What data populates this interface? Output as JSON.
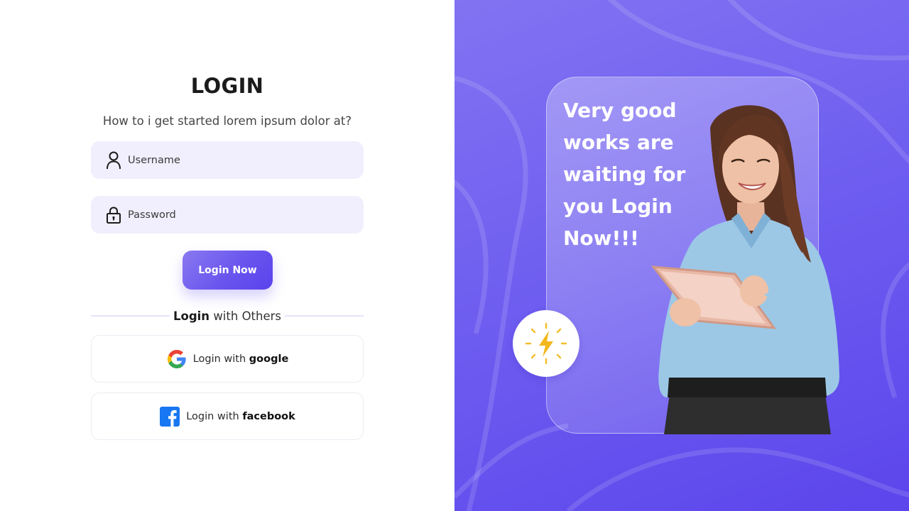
{
  "login": {
    "title": "LOGIN",
    "subtitle": "How to i get started lorem ipsum dolor at?",
    "username_placeholder": "Username",
    "password_placeholder": "Password",
    "submit_label": "Login Now",
    "divider_bold": "Login",
    "divider_text": "with Others",
    "google_prefix": "Login with",
    "google_bold": "google",
    "facebook_prefix": "Login with",
    "facebook_bold": "facebook"
  },
  "promo": {
    "headline_lines": [
      "Very good",
      "works are",
      "waiting for",
      "you Login",
      "Now!!!"
    ]
  },
  "icons": {
    "username": "user-icon",
    "password": "lock-icon",
    "google": "google-logo-icon",
    "facebook": "facebook-logo-icon",
    "badge": "lightning-bolt-icon"
  },
  "colors": {
    "accent": "#6a55ee",
    "field_bg": "#f1effd",
    "panel_gradient_start": "#8273f2",
    "panel_gradient_end": "#5c45ec"
  }
}
